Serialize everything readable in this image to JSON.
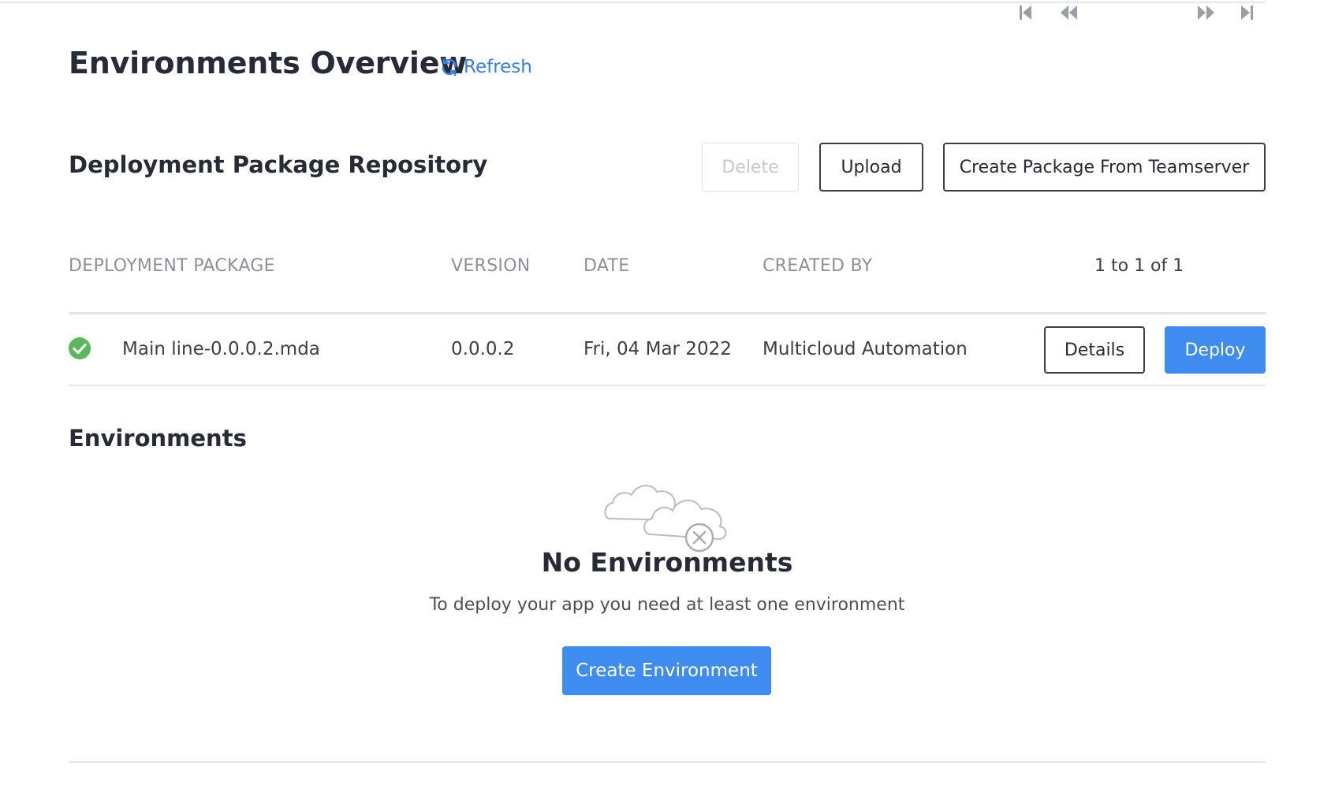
{
  "header": {
    "title": "Environments Overview",
    "refresh_label": "Refresh"
  },
  "repository": {
    "title": "Deployment Package Repository",
    "buttons": {
      "delete": "Delete",
      "upload": "Upload",
      "create_package": "Create Package From Teamserver"
    },
    "columns": [
      "DEPLOYMENT PACKAGE",
      "VERSION",
      "DATE",
      "CREATED BY"
    ],
    "pager": {
      "text": "1 to 1 of 1"
    },
    "rows": [
      {
        "status": "success",
        "package": "Main line-0.0.0.2.mda",
        "version": "0.0.0.2",
        "date": "Fri, 04 Mar 2022",
        "created_by": "Multicloud Automation",
        "details_label": "Details",
        "deploy_label": "Deploy"
      }
    ]
  },
  "environments": {
    "title": "Environments",
    "empty_icon": "cloud-error-icon",
    "empty_title": "No Environments",
    "empty_message": "To deploy your app you need at least one environment",
    "create_label": "Create Environment"
  },
  "colors": {
    "primary": "#3f8cf0",
    "link": "#2f80ed",
    "success": "#5cb85c",
    "text_dark": "#262b36",
    "text_muted": "#8c9099"
  },
  "icons": {
    "refresh": "refresh-icon",
    "status": "check-circle-icon",
    "first_page": "first-page-icon",
    "prev_page": "prev-page-icon",
    "next_page": "next-page-icon",
    "last_page": "last-page-icon"
  }
}
